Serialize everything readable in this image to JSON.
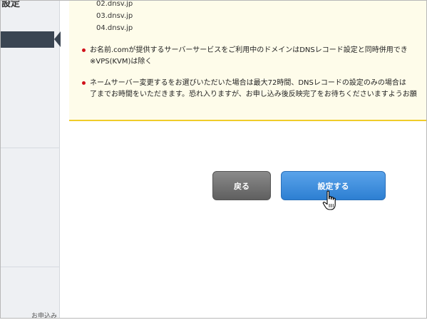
{
  "sidebar": {
    "heading": "設定",
    "bottom_text": "お申込み"
  },
  "note": {
    "servers": [
      "02.dnsv.jp",
      "03.dnsv.jp",
      "04.dnsv.jp"
    ],
    "item1": {
      "line1": "お名前.comが提供するサーバーサービスをご利用中のドメインはDNSレコード設定と同時併用でき",
      "line2": "※VPS(KVM)は除く"
    },
    "item2": {
      "line1": "ネームサーバー変更するをお選びいただいた場合は最大72時間、DNSレコードの設定のみの場合は",
      "line2": "了までお時間をいただきます。恐れ入りますが、お申し込み後反映完了をお待ちくださいますようお願"
    }
  },
  "buttons": {
    "back_label": "戻る",
    "submit_label": "設定する"
  },
  "colors": {
    "sidebar_active": "#3a4552",
    "note_background": "#fefcea",
    "note_border": "#f0cc2a",
    "bullet": "#d0101a",
    "back_button": "#6e6e6e",
    "submit_button": "#3a8be0"
  },
  "icons": [
    "hand-pointer-cursor"
  ]
}
